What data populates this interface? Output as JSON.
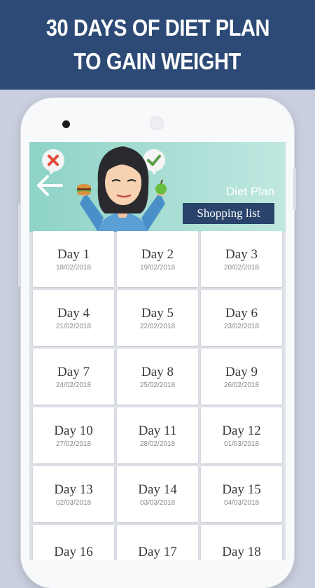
{
  "banner": {
    "line1": "30 DAYS OF DIET PLAN",
    "line2": "TO GAIN WEIGHT"
  },
  "header": {
    "title": "Diet Plan",
    "shopping_button": "Shopping list"
  },
  "days": [
    {
      "label": "Day 1",
      "date": "18/02/2018"
    },
    {
      "label": "Day 2",
      "date": "19/02/2018"
    },
    {
      "label": "Day 3",
      "date": "20/02/2018"
    },
    {
      "label": "Day 4",
      "date": "21/02/2018"
    },
    {
      "label": "Day 5",
      "date": "22/02/2018"
    },
    {
      "label": "Day 6",
      "date": "23/02/2018"
    },
    {
      "label": "Day 7",
      "date": "24/02/2018"
    },
    {
      "label": "Day 8",
      "date": "25/02/2018"
    },
    {
      "label": "Day 9",
      "date": "26/02/2018"
    },
    {
      "label": "Day 10",
      "date": "27/02/2018"
    },
    {
      "label": "Day 11",
      "date": "28/02/2018"
    },
    {
      "label": "Day 12",
      "date": "01/03/2018"
    },
    {
      "label": "Day 13",
      "date": "02/03/2018"
    },
    {
      "label": "Day 14",
      "date": "03/03/2018"
    },
    {
      "label": "Day 15",
      "date": "04/03/2018"
    },
    {
      "label": "Day 16",
      "date": ""
    },
    {
      "label": "Day 17",
      "date": ""
    },
    {
      "label": "Day 18",
      "date": ""
    }
  ],
  "colors": {
    "banner": "#2c4a75",
    "header_teal": "#9fd9cf",
    "button": "#29436b",
    "background": "#c9cfdf"
  },
  "icons": [
    "back-arrow-icon",
    "reject-x-icon",
    "approve-check-icon"
  ]
}
